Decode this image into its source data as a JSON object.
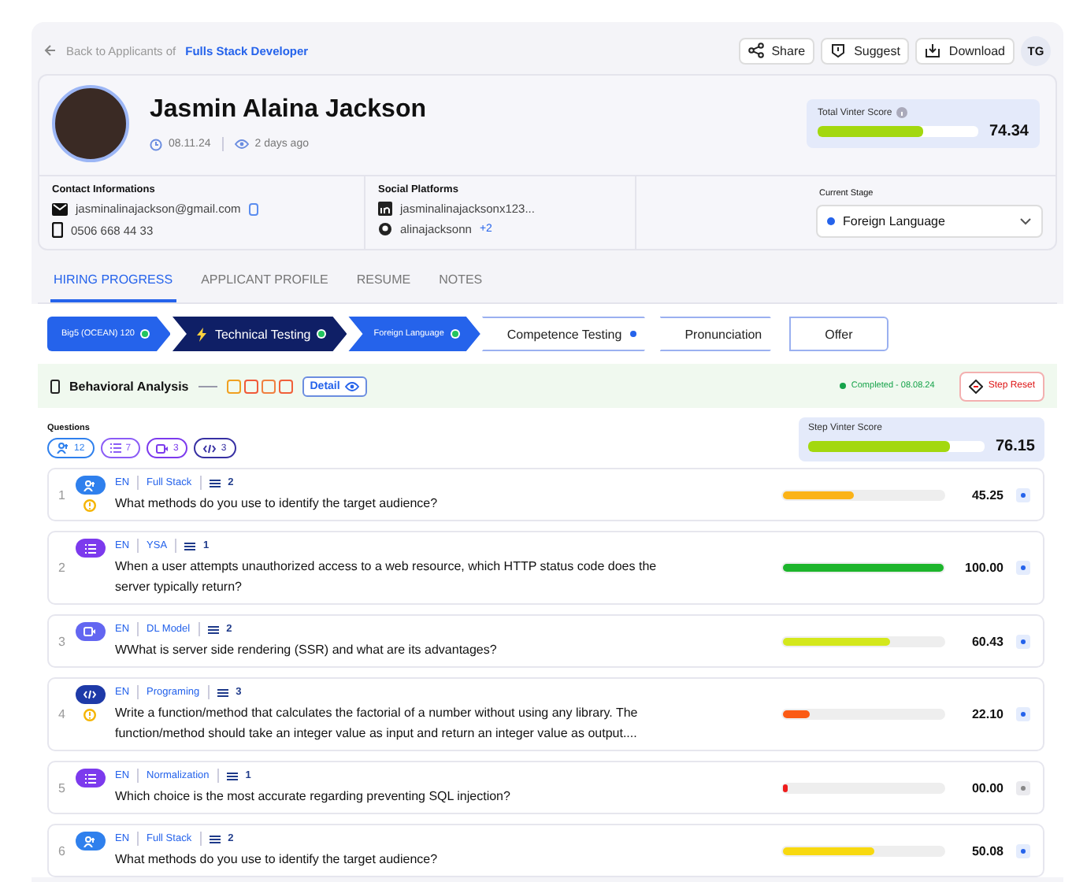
{
  "topbar": {
    "back_label": "Back to Applicants of",
    "job_link": "Fulls Stack Developer",
    "buttons": [
      {
        "kind": "share",
        "label": "Share"
      },
      {
        "kind": "suggest",
        "label": "Suggest"
      },
      {
        "kind": "download",
        "label": "Download"
      }
    ],
    "user_initials": "TG"
  },
  "profile": {
    "name": "Jasmin Alaina Jackson",
    "date": "08.11.24",
    "seen": "2 days ago",
    "total_score": {
      "label": "Total Vinter Score",
      "level": 0.66,
      "value": "74.34"
    }
  },
  "contact": {
    "title": "Contact Informations",
    "email": "jasminalinajackson@gmail.com",
    "phone": "0506 668 44 33"
  },
  "social": {
    "title": "Social Platforms",
    "linkedin": "jasminalinajacksonx123...",
    "github": "alinajacksonn",
    "more": "+2"
  },
  "current_stage": {
    "label": "Current Stage",
    "value": "Foreign Language",
    "color": "#2563eb"
  },
  "tabs": [
    {
      "label": "HIRING PROGRESS",
      "selected": true
    },
    {
      "label": "APPLICANT PROFILE",
      "selected": false
    },
    {
      "label": "RESUME",
      "selected": false
    },
    {
      "label": "NOTES",
      "selected": false
    }
  ],
  "stages": [
    {
      "label": "Big5 (OCEAN) 120",
      "kind": "done",
      "color": "#22c55e"
    },
    {
      "label": "Technical Testing",
      "kind": "current",
      "color": "#22c55e"
    },
    {
      "label": "Foreign Language",
      "kind": "done",
      "color": "#22c55e"
    },
    {
      "label": "Competence Testing",
      "kind": "pending",
      "color": "#2563eb"
    },
    {
      "label": "Pronunciation",
      "kind": "pending"
    },
    {
      "label": "Offer",
      "kind": "pending"
    }
  ],
  "step": {
    "title": "Behavioral Analysis",
    "detail_button": "Detail",
    "status": "Completed - 08.08.24",
    "reset_button": "Step Reset"
  },
  "questions": {
    "title": "Questions",
    "filters": [
      {
        "kind": "audience",
        "count": "12"
      },
      {
        "kind": "list",
        "count": "7"
      },
      {
        "kind": "video",
        "count": "3"
      },
      {
        "kind": "code",
        "count": "3"
      }
    ],
    "step_score": {
      "label": "Step Vinter Score",
      "level": 0.8,
      "value": "76.15"
    },
    "items": [
      {
        "number": "1",
        "kind": "audience",
        "lang": "EN",
        "tag": "Full Stack",
        "count": "2",
        "warning": true,
        "text": "What methods do you use to identify the target audience?",
        "level": 0.44,
        "color": "#fbb318",
        "score": "45.25",
        "active": true
      },
      {
        "number": "2",
        "kind": "list",
        "lang": "EN",
        "tag": "YSA",
        "count": "1",
        "warning": false,
        "text": "When a user attempts unauthorized access to a web resource, which HTTP status code does the server typically return?",
        "level": 1,
        "color": "#1db52c",
        "score": "100.00",
        "active": true
      },
      {
        "number": "3",
        "kind": "video",
        "lang": "EN",
        "tag": "DL Model",
        "count": "2",
        "warning": false,
        "text": "WWhat is server side rendering (SSR) and what are its advantages?",
        "level": 0.67,
        "color": "#d4e81c",
        "score": "60.43",
        "active": true
      },
      {
        "number": "4",
        "kind": "code",
        "lang": "EN",
        "tag": "Programing",
        "count": "3",
        "warning": true,
        "text": "Write a function/method that calculates the factorial of a number without using any library. The function/method should take an integer value as input and return an integer value as output....",
        "level": 0.17,
        "color": "#fb5a14",
        "score": "22.10",
        "active": true
      },
      {
        "number": "5",
        "kind": "list",
        "lang": "EN",
        "tag": "Normalization",
        "count": "1",
        "warning": false,
        "text": "Which choice is the most accurate regarding preventing SQL injection?",
        "level": 0.03,
        "color": "#ef1c1c",
        "score": "00.00",
        "active": false
      },
      {
        "number": "6",
        "kind": "audience",
        "lang": "EN",
        "tag": "Full Stack",
        "count": "2",
        "warning": false,
        "text": "What methods do you use to identify the target audience?",
        "level": 0.57,
        "color": "#f8d90f",
        "score": "50.08",
        "active": true
      }
    ]
  }
}
